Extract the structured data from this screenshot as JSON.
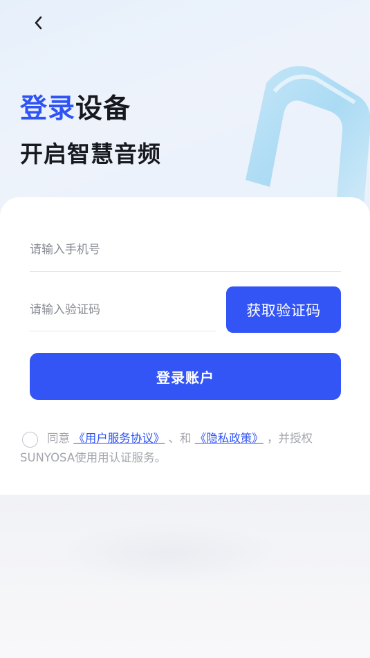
{
  "header": {
    "back_icon": "chevron-left-icon"
  },
  "hero": {
    "title_accent": "登录",
    "title_rest": "设备",
    "subtitle": "开启智慧音频"
  },
  "form": {
    "phone_placeholder": "请输入手机号",
    "phone_value": "",
    "code_placeholder": "请输入验证码",
    "code_value": "",
    "get_code_label": "获取验证码",
    "login_label": "登录账户"
  },
  "agreement": {
    "checked": false,
    "prefix": "同意",
    "user_agreement": "《用户服务协议》",
    "separator": "、和",
    "privacy_policy": "《隐私政策》",
    "suffix": "，并授权SUNYOSA使用用认证服务。"
  },
  "colors": {
    "accent": "#3355f6",
    "title_text": "#17191f",
    "muted_text": "#a3a5ad"
  }
}
